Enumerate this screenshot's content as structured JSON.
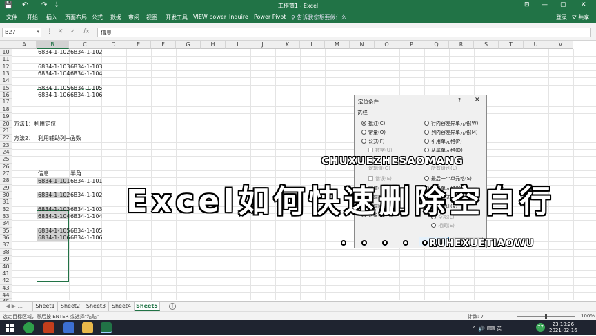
{
  "titlebar": {
    "title": "工作簿1 - Excel",
    "qa_save": "💾",
    "qa_undo": "↶",
    "qa_redo": "↷",
    "qa_more": "⇣",
    "min": "—",
    "max": "▢",
    "close": "✕",
    "ribbon_opts": "⊡"
  },
  "ribbon": {
    "tabs": [
      "文件",
      "开始",
      "插入",
      "页面布局",
      "公式",
      "数据",
      "审阅",
      "视图",
      "开发工具",
      "VIEW power",
      "Inquire",
      "Power Pivot"
    ],
    "tellme": "♀ 告诉我您想要做什么...",
    "login": "登录",
    "share": "⛛ 共享"
  },
  "formula_bar": {
    "name_box": "B27",
    "name_arrow": "▾",
    "more": "⋮",
    "cancel": "✕",
    "enter": "✓",
    "fx": "fx",
    "value": "信息"
  },
  "columns": [
    "A",
    "B",
    "C",
    "D",
    "E",
    "F",
    "G",
    "H",
    "I",
    "J",
    "K",
    "L",
    "M",
    "N",
    "O",
    "P",
    "Q",
    "R",
    "S",
    "T",
    "U",
    "V"
  ],
  "rows": [
    "10",
    "11",
    "12",
    "13",
    "14",
    "15",
    "16",
    "17",
    "18",
    "19",
    "20",
    "21",
    "22",
    "23",
    "24",
    "25",
    "26",
    "27",
    "28",
    "29",
    "30",
    "31",
    "32",
    "33",
    "34",
    "35",
    "36",
    "37",
    "38",
    "39",
    "40",
    "41",
    "42",
    "43",
    "44",
    "45"
  ],
  "cells": {
    "r10b": "6834-1-102",
    "r10c": "6834-1-102",
    "r12b": "6834-1-103",
    "r12c": "6834-1-103",
    "r13b": "6834-1-104",
    "r13c": "6834-1-104",
    "r15b": "6834-1-105",
    "r15c": "6834-1-105",
    "r16b": "6834-1-106",
    "r16c": "6834-1-106",
    "r20a": "方法1：利用定位",
    "r22a": "方法2：",
    "r22b": "利用辅助列+函数",
    "r27b": "信息",
    "r27c": "半角",
    "r28b": "6834-1-101",
    "r28c": "6834-1-101",
    "r30b": "6834-1-102",
    "r30c": "6834-1-102",
    "r32b": "6834-1-103",
    "r32c": "6834-1-103",
    "r33b": "6834-1-104",
    "r33c": "6834-1-104",
    "r35b": "6834-1-105",
    "r35c": "6834-1-105",
    "r36b": "6834-1-106",
    "r36c": "6834-1-106"
  },
  "dialog": {
    "title": "定位条件",
    "help": "?",
    "close": "✕",
    "group": "选择",
    "left_options": [
      "批注(C)",
      "常量(O)",
      "公式(F)",
      "数字(U)",
      "逻辑值(G)",
      "错误(E)",
      "空值(K)",
      "当前区域(R)",
      "当前数组(A)",
      "对象(B)"
    ],
    "right_options": [
      "行内容差异单元格(W)",
      "列内容差异单元格(M)",
      "引用单元格(P)",
      "从属单元格(D)",
      "直属(I)",
      "所有级别(L)",
      "最后一个单元格(S)",
      "可见单元格(Y)",
      "条件格式(T)",
      "数据验证(V)",
      "全部(L)",
      "相同(E)"
    ]
  },
  "watermark": {
    "top": "CHUXUEZHESAOMANG",
    "main": "Excel如何快速删除空白行",
    "bottom": "RUHEXUETIAOWU"
  },
  "sheets": [
    "Sheet1",
    "Sheet2",
    "Sheet3",
    "Sheet4",
    "Sheet5"
  ],
  "active_sheet": "Sheet5",
  "sheet_nav": "◀ ▶ ...",
  "add_sheet": "+",
  "status": {
    "message": "选定目标区域，然后按 ENTER 或选择\"粘贴\"",
    "count": "计数: 7",
    "zoom": "100%"
  },
  "taskbar": {
    "time": "23:10:26",
    "date": "2021-02-16",
    "badge": "77",
    "tray_icons": "⌃ 🔊 ⌨ 英"
  },
  "colors": {
    "excel_green": "#217346",
    "selection_gray": "#d0d0d0",
    "taskbar": "#1f2430"
  }
}
